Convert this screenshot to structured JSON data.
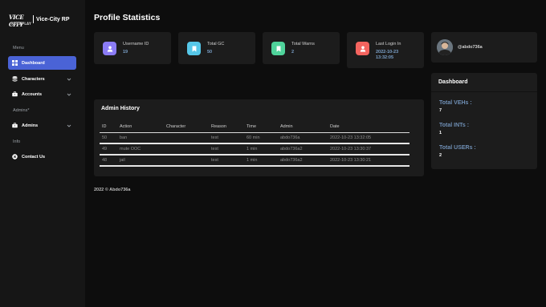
{
  "brand": {
    "logo_text": "VICE CITY",
    "logo_sub": "ROLEPLAY",
    "name": "Vice-City RP"
  },
  "sidebar": {
    "sections": [
      "Menu",
      "Admins*",
      "Info"
    ],
    "items": [
      {
        "label": "Dashboard",
        "icon": "grid-icon",
        "active": true
      },
      {
        "label": "Characters",
        "icon": "database-icon"
      },
      {
        "label": "Accounts",
        "icon": "briefcase-icon"
      },
      {
        "label": "Admins",
        "icon": "briefcase-icon"
      },
      {
        "label": "Contact Us",
        "icon": "x-circle-icon"
      }
    ]
  },
  "main": {
    "title": "Profile Statistics"
  },
  "stats": [
    {
      "label": "Username ID",
      "value": "19",
      "icon": "user-icon",
      "color": "#8b7cf6"
    },
    {
      "label": "Total GC",
      "value": "50",
      "icon": "bookmark-icon",
      "color": "#56c7e8"
    },
    {
      "label": "Total Warns",
      "value": "2",
      "icon": "bookmark-icon",
      "color": "#4fd39b"
    },
    {
      "label": "Last Login In",
      "value_line1": "2022-10-23",
      "value_line2": "13:32:05",
      "icon": "user-icon",
      "color": "#f4645f"
    }
  ],
  "profile": {
    "username": "@abdo736a"
  },
  "dashboard_panel": {
    "title": "Dashboard",
    "stats": [
      {
        "label": "Total VEHs :",
        "value": "7"
      },
      {
        "label": "Total INTs :",
        "value": "1"
      },
      {
        "label": "Total USERs :",
        "value": "2"
      }
    ]
  },
  "admin_history": {
    "title": "Admin History",
    "columns": [
      "ID",
      "Action",
      "Character",
      "Reason",
      "Time",
      "Admin",
      "Date"
    ],
    "rows": [
      [
        "50",
        "ban",
        "",
        "test",
        "60 min",
        "abdo736a",
        "2022-10-23 13:32:05"
      ],
      [
        "49",
        "mute OOC",
        "",
        "test",
        "1 min",
        "abdo736a2",
        "2022-10-23 13:30:37"
      ],
      [
        "48",
        "jail",
        "",
        "test",
        "1 min",
        "abdo736a2",
        "2022-10-23 13:30:21"
      ]
    ]
  },
  "footer": {
    "text": "2022 © Abdo736a"
  },
  "colors": {
    "accent": "#4a63d6",
    "sidebar_bg": "#161616",
    "card_bg": "#1c1c1c",
    "page_bg": "#0d0d0d"
  }
}
